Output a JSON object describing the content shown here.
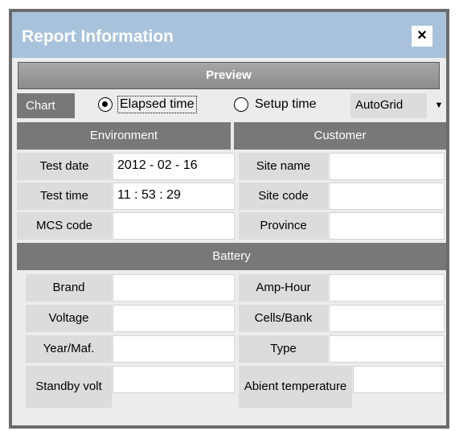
{
  "window": {
    "title": "Report Information",
    "close_label": "×"
  },
  "preview": {
    "label": "Preview"
  },
  "chart": {
    "label": "Chart",
    "options": [
      {
        "label": "Elapsed time",
        "selected": true
      },
      {
        "label": "Setup time",
        "selected": false
      }
    ],
    "dropdown": {
      "value": "AutoGrid",
      "arrow": "▼"
    }
  },
  "environment": {
    "header": "Environment",
    "fields": [
      {
        "label": "Test date",
        "value": "2012 - 02 - 16"
      },
      {
        "label": "Test time",
        "value": "11 : 53 : 29"
      },
      {
        "label": "MCS code",
        "value": ""
      }
    ]
  },
  "customer": {
    "header": "Customer",
    "fields": [
      {
        "label": "Site name",
        "value": ""
      },
      {
        "label": "Site code",
        "value": ""
      },
      {
        "label": "Province",
        "value": ""
      }
    ]
  },
  "battery": {
    "header": "Battery",
    "left_fields": [
      {
        "label": "Brand",
        "value": ""
      },
      {
        "label": "Voltage",
        "value": ""
      },
      {
        "label": "Year/Maf.",
        "value": ""
      },
      {
        "label": "Standby volt",
        "value": ""
      }
    ],
    "right_fields": [
      {
        "label": "Amp-Hour",
        "value": ""
      },
      {
        "label": "Cells/Bank",
        "value": ""
      },
      {
        "label": "Type",
        "value": ""
      },
      {
        "label": "Abient temperature",
        "value": ""
      }
    ]
  }
}
